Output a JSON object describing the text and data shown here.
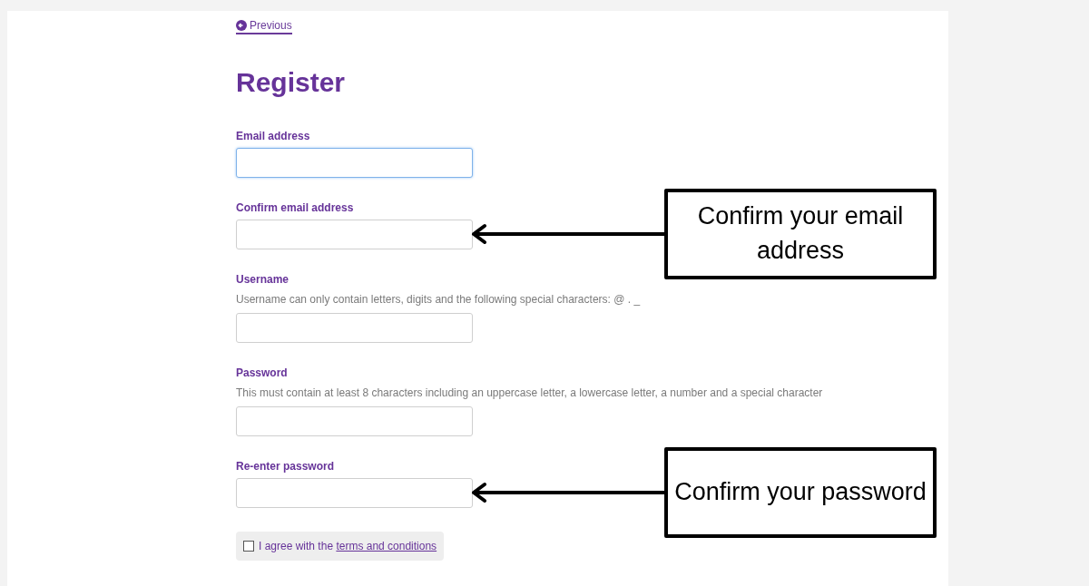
{
  "back_link": {
    "label": "Previous"
  },
  "title": "Register",
  "fields": [
    {
      "label": "Email address",
      "focused": true
    },
    {
      "label": "Confirm email address",
      "focused": false,
      "callout": "Confirm your email address"
    },
    {
      "label": "Username",
      "focused": false,
      "hint": "Username can only contain letters, digits and the following special characters: @ . _"
    },
    {
      "label": "Password",
      "focused": false,
      "hint": "This must contain at least 8 characters including an uppercase letter, a lowercase letter, a number and a special character"
    },
    {
      "label": "Re-enter password",
      "focused": false,
      "callout": "Confirm your password"
    }
  ],
  "agree": {
    "text": "I agree with the ",
    "link": "terms and conditions",
    "checked": false
  }
}
